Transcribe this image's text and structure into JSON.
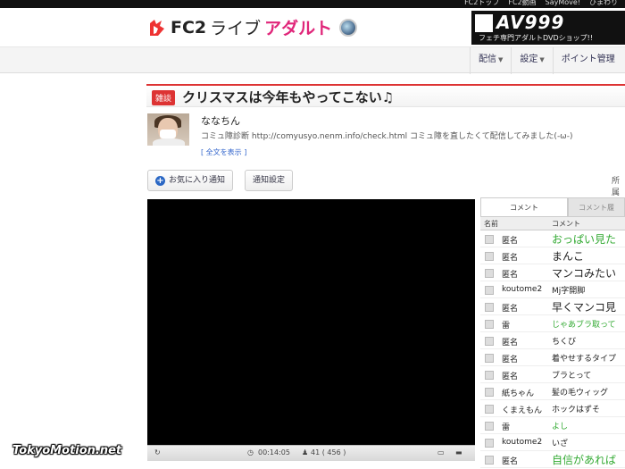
{
  "top_links": [
    "FC2トップ",
    "FC2動画",
    "SayMove!",
    "ひまわり"
  ],
  "logo": {
    "fc2": "FC2",
    "live": "ライブ",
    "adult": "アダルト"
  },
  "ad": {
    "big": "AV999",
    "small": "フェチ専門アダルトDVDショップ!!"
  },
  "nav": {
    "haishin": "配信",
    "settei": "設定",
    "point": "ポイント管理"
  },
  "title": {
    "badge": "雑談",
    "text": "クリスマスは今年もやってこない♫"
  },
  "user": {
    "name": "ななちん",
    "desc": "コミュ障診断 http://comyusyo.nenm.info/check.html コミュ障を直したくて配信してみました(-ω-)",
    "more": "[ 全文を表示 ]"
  },
  "buttons": {
    "favorite": "お気に入り通知",
    "notify": "通知設定",
    "shozoku": "所属"
  },
  "player": {
    "time": "00:14:05",
    "viewers": "41 ( 456 )"
  },
  "chat": {
    "tab_comment": "コメント",
    "tab_other": "コメント履",
    "col_name": "名前",
    "col_comment": "コメント",
    "rows": [
      {
        "name": "匿名",
        "comment": "おっぱい見た",
        "style": "big green"
      },
      {
        "name": "匿名",
        "comment": "まんこ",
        "style": "big dark"
      },
      {
        "name": "匿名",
        "comment": "マンコみたい",
        "style": "big dark"
      },
      {
        "name": "koutome2",
        "comment": "Mj字開脚",
        "style": "dark"
      },
      {
        "name": "匿名",
        "comment": "早くマンコ見",
        "style": "big dark"
      },
      {
        "name": "雷",
        "comment": "じゃあブラ取って",
        "style": "green"
      },
      {
        "name": "匿名",
        "comment": "ちくび",
        "style": "dark"
      },
      {
        "name": "匿名",
        "comment": "着やせするタイプ",
        "style": "dark"
      },
      {
        "name": "匿名",
        "comment": "ブラとって",
        "style": "dark"
      },
      {
        "name": "紙ちゃん",
        "comment": "髪の毛ウィッグ",
        "style": "dark"
      },
      {
        "name": "くまえもん",
        "comment": "ホックはずそ",
        "style": "dark"
      },
      {
        "name": "雷",
        "comment": "よし",
        "style": "green"
      },
      {
        "name": "koutome2",
        "comment": "いざ",
        "style": "dark"
      },
      {
        "name": "匿名",
        "comment": "自信があれば",
        "style": "big green"
      }
    ]
  },
  "watermark": "TokyoMotion.net"
}
